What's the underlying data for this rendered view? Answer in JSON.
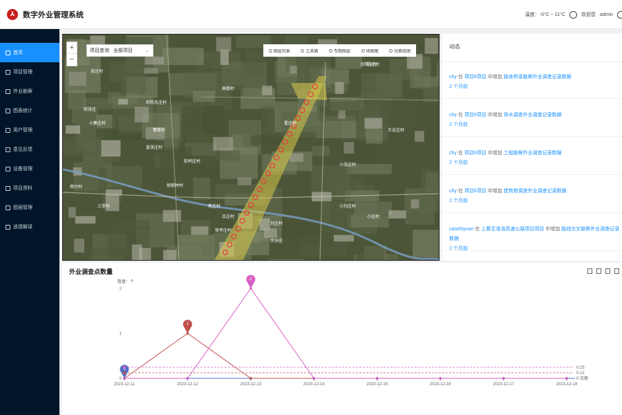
{
  "header": {
    "title": "数字外业管理系统",
    "temperature": "温度：-5°C ~ 11°C",
    "welcome": "欢迎您",
    "username": "admin"
  },
  "sidebar": {
    "items": [
      {
        "label": "首页",
        "icon": "home-icon",
        "active": true
      },
      {
        "label": "项目管理",
        "icon": "folder-icon"
      },
      {
        "label": "外业勘察",
        "icon": "survey-icon"
      },
      {
        "label": "图表统计",
        "icon": "bar-chart-icon"
      },
      {
        "label": "用户管理",
        "icon": "user-icon"
      },
      {
        "label": "意见反馈",
        "icon": "feedback-icon"
      },
      {
        "label": "设备管理",
        "icon": "wrench-icon"
      },
      {
        "label": "项目资料",
        "icon": "document-icon"
      },
      {
        "label": "图层管理",
        "icon": "layers-icon"
      },
      {
        "label": "遥感解译",
        "icon": "satellite-icon"
      }
    ]
  },
  "map": {
    "project_query_label": "项目查询",
    "project_selected": "全部项目",
    "toolbar": [
      {
        "label": "图层列表",
        "icon": "list-icon"
      },
      {
        "label": "工具箱",
        "icon": "tool-icon"
      },
      {
        "label": "专题图层",
        "icon": "pin-icon"
      },
      {
        "label": "地图图",
        "icon": "map-icon"
      },
      {
        "label": "切换底图",
        "icon": "swap-icon"
      }
    ],
    "colors": {
      "corridor": "#d6c84a",
      "points": "#e8393e",
      "river": "#7aa0c8"
    },
    "places": [
      "张庄村",
      "前张庄",
      "后陈东庄村",
      "曹楼村",
      "小集庄村",
      "直张庄村",
      "胡家林村",
      "前柯庄村",
      "小刘庄村",
      "王吉庄村",
      "陈庄村",
      "小张庄村",
      "高楼村",
      "三里村",
      "焦庄村",
      "吕庄村",
      "徐李庄村",
      "刘庄村",
      "大沙庄",
      "西付村",
      "小庄村",
      "翟庄村",
      "北陈庄村"
    ]
  },
  "activity": {
    "title": "动态",
    "items": [
      {
        "user": "chy",
        "at": "在",
        "project": "项目6项目",
        "action": "中增加",
        "record": "路肯桥梁勘察外业调查记录数据",
        "time": "2 个月前"
      },
      {
        "user": "chy",
        "at": "在",
        "project": "项目6项目",
        "action": "中增加",
        "record": "排水调查外业调查记录数据",
        "time": "2 个月前"
      },
      {
        "user": "chy",
        "at": "在",
        "project": "项目6项目",
        "action": "中增加",
        "record": "工程勘察外业调查记录数据",
        "time": "2 个月前"
      },
      {
        "user": "chy",
        "at": "在",
        "project": "项目6项目",
        "action": "中增加",
        "record": "建筑物调查外业调查记录数据",
        "time": "2 个月前"
      },
      {
        "user": "caozhiyuan",
        "at": "在",
        "project": "上蔡至淮滨高速公路项目项目",
        "action": "中增加",
        "record": "路线交叉勘察外业调查记录数据",
        "time": "2 个月前"
      }
    ]
  },
  "chart_data": {
    "type": "line",
    "title": "外业调查点数量",
    "ylabel": "数量：个",
    "categories": [
      "2023-12-11",
      "2023-12-12",
      "2023-12-13",
      "2023-12-14",
      "2023-12-15",
      "2023-12-16",
      "2023-12-17",
      "2023-12-18"
    ],
    "ylim": [
      0,
      2
    ],
    "yticks": [
      0,
      1,
      2
    ],
    "series": [
      {
        "values": [
          0,
          0,
          0,
          0,
          0,
          0,
          0,
          0
        ],
        "color": "#5470c6",
        "label_peak": "0",
        "end_label": "0 日期"
      },
      {
        "values": [
          0,
          1,
          0,
          0,
          0,
          0,
          0,
          0
        ],
        "color": "#c0504d",
        "label_peak": "1",
        "end_label": "0.13"
      },
      {
        "values": [
          0,
          0,
          2,
          0,
          0,
          0,
          0,
          0
        ],
        "color": "#d85fc4",
        "label_peak": "2",
        "end_label": "0.25"
      }
    ],
    "legend": "right"
  }
}
